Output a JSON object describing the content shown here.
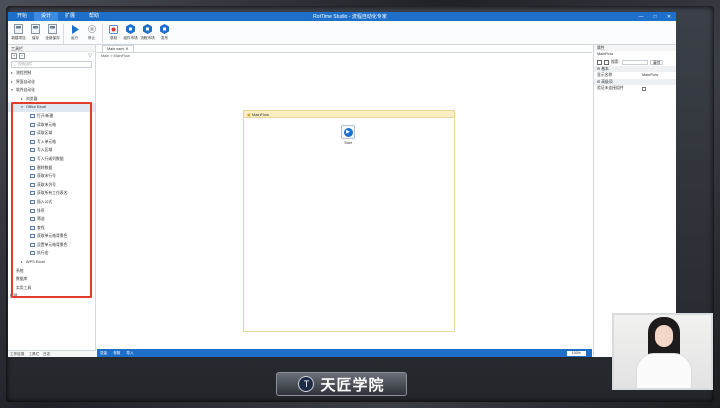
{
  "titlebar": {
    "tabs": [
      "开始",
      "设计",
      "扩展",
      "帮助"
    ],
    "title": "RotTime Studio - 流程自动化专家",
    "controls": [
      "—",
      "□",
      "✕"
    ]
  },
  "ribbon": [
    {
      "label": "新建项目",
      "icon": "new-project-icon"
    },
    {
      "label": "保存",
      "icon": "save-icon"
    },
    {
      "label": "全部保存",
      "icon": "save-all-icon"
    },
    {
      "label": "运行",
      "icon": "run-icon"
    },
    {
      "label": "停止",
      "icon": "stop-icon"
    },
    {
      "label": "录制",
      "icon": "record-icon"
    },
    {
      "label": "组件市场",
      "icon": "component-market-icon"
    },
    {
      "label": "流程市场",
      "icon": "flow-market-icon"
    },
    {
      "label": "发布",
      "icon": "publish-icon"
    }
  ],
  "left_panel": {
    "title": "工具栏",
    "search_placeholder": "搜索组件",
    "tree": [
      {
        "label": "流程控制",
        "level": 0,
        "arrow": "▸"
      },
      {
        "label": "界面自动化",
        "level": 0,
        "arrow": "▸"
      },
      {
        "label": "软件自动化",
        "level": 0,
        "arrow": "▾"
      },
      {
        "label": "浏览器",
        "level": 1,
        "arrow": "▸"
      },
      {
        "label": "Office Excel",
        "level": 1,
        "arrow": "▾",
        "selected": true
      },
      {
        "label": "打开/新建",
        "level": 2,
        "icon": true
      },
      {
        "label": "读取单元格",
        "level": 2,
        "icon": true
      },
      {
        "label": "读取区域",
        "level": 2,
        "icon": true
      },
      {
        "label": "写入单元格",
        "level": 2,
        "icon": true
      },
      {
        "label": "写入区域",
        "level": 2,
        "icon": true
      },
      {
        "label": "写入行或列数据",
        "level": 2,
        "icon": true
      },
      {
        "label": "删除数据",
        "level": 2,
        "icon": true
      },
      {
        "label": "获取末行号",
        "level": 2,
        "icon": true
      },
      {
        "label": "获取末列号",
        "level": 2,
        "icon": true
      },
      {
        "label": "获取所有工作表名",
        "level": 2,
        "icon": true
      },
      {
        "label": "插入公式",
        "level": 2,
        "icon": true
      },
      {
        "label": "排序",
        "level": 2,
        "icon": true
      },
      {
        "label": "筛选",
        "level": 2,
        "icon": true
      },
      {
        "label": "查找",
        "level": 2,
        "icon": true
      },
      {
        "label": "获取单元格背景色",
        "level": 2,
        "icon": true
      },
      {
        "label": "设置单元格背景色",
        "level": 2,
        "icon": true
      },
      {
        "label": "执行宏",
        "level": 2,
        "icon": true
      },
      {
        "label": "WPS Excel",
        "level": 1,
        "arrow": "▸"
      },
      {
        "label": "系统",
        "level": 0,
        "arrow": "▸"
      },
      {
        "label": "数据库",
        "level": 0,
        "arrow": "▸"
      },
      {
        "label": "实用工具",
        "level": 0,
        "arrow": "▸"
      },
      {
        "label": "扩展",
        "level": -1,
        "arrow": ""
      }
    ],
    "bottom_tabs": [
      "工作目录",
      "工具栏",
      "日志"
    ]
  },
  "center": {
    "doc_tab": "Main.xaml ✕",
    "breadcrumb": "Main  >  MainFlow",
    "flow_title": "MainFlow",
    "start_label": "Start",
    "status_items": [
      "变量",
      "参数",
      "导入"
    ],
    "zoom": "100%"
  },
  "right_panel": {
    "title": "属性",
    "object": "MainFlow",
    "search_placeholder": "搜索:",
    "clear_label": "清除",
    "section_basic": "基本",
    "display_name_key": "显示名称",
    "display_name_val": "MainFlow",
    "section_advanced": "高级项",
    "continue_key": "验证未连接组件"
  },
  "logo": {
    "text": "天匠学院",
    "emblem": "T"
  }
}
